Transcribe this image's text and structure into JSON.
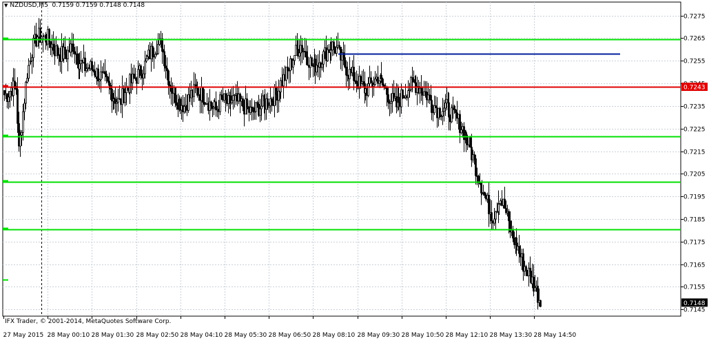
{
  "header": {
    "symbol": "NZDUSD,M5",
    "ohlc": "0.7159 0.7159 0.7148 0.7148"
  },
  "footer": {
    "copyright": "IFX Trader, © 2001-2014, MetaQuotes Software Corp."
  },
  "colors": {
    "background": "#ffffff",
    "grid": "#c8d0d8",
    "candle": "#000000",
    "green_levels": "#00e000",
    "red_level": "#e00000",
    "blue_line": "#001f9e",
    "price_tag_red": "#e00000",
    "price_tag_current": "#000000"
  },
  "chart_data": {
    "type": "candlestick",
    "symbol": "NZDUSD",
    "timeframe": "M5",
    "ylim": [
      0.7142,
      0.7281
    ],
    "y_ticks": [
      "0.7275",
      "0.7265",
      "0.7255",
      "0.7245",
      "0.7235",
      "0.7225",
      "0.7215",
      "0.7205",
      "0.7195",
      "0.7185",
      "0.7175",
      "0.7165",
      "0.7155",
      "0.7145"
    ],
    "x_ticks": [
      "27 May 2015",
      "28 May 00:10",
      "28 May 01:30",
      "28 May 02:50",
      "28 May 04:10",
      "28 May 05:30",
      "28 May 06:50",
      "28 May 08:10",
      "28 May 09:30",
      "28 May 10:50",
      "28 May 12:10",
      "28 May 13:30",
      "28 May 14:50"
    ],
    "grid": true,
    "horizontal_levels": [
      {
        "price": 0.72645,
        "color": "green"
      },
      {
        "price": 0.72435,
        "color": "red",
        "label": "0.7243"
      },
      {
        "price": 0.72215,
        "color": "green"
      },
      {
        "price": 0.72015,
        "color": "green"
      },
      {
        "price": 0.71805,
        "color": "green"
      }
    ],
    "trend_line": {
      "from_time": "28 May 08:20",
      "to_time": "28 May 15:40",
      "price": 0.72582,
      "color": "blue"
    },
    "current_price": "0.7148",
    "close_path": [
      [
        0.724,
        3
      ],
      [
        0.7243,
        3
      ],
      [
        0.7243,
        4
      ],
      [
        0.7215,
        2
      ],
      [
        0.725,
        6
      ],
      [
        0.726,
        4
      ],
      [
        0.7266,
        4
      ],
      [
        0.7265,
        5
      ],
      [
        0.7265,
        3
      ],
      [
        0.726,
        5
      ],
      [
        0.7258,
        4
      ],
      [
        0.7258,
        5
      ],
      [
        0.7262,
        5
      ],
      [
        0.7255,
        4
      ],
      [
        0.7252,
        5
      ],
      [
        0.7252,
        4
      ],
      [
        0.725,
        4
      ],
      [
        0.7248,
        4
      ],
      [
        0.7245,
        4
      ],
      [
        0.724,
        5
      ],
      [
        0.7236,
        5
      ],
      [
        0.7242,
        4
      ],
      [
        0.7245,
        4
      ],
      [
        0.7248,
        5
      ],
      [
        0.7252,
        5
      ],
      [
        0.7258,
        5
      ],
      [
        0.7262,
        5
      ],
      [
        0.7262,
        4
      ],
      [
        0.7245,
        6
      ],
      [
        0.7238,
        5
      ],
      [
        0.7235,
        6
      ],
      [
        0.724,
        5
      ],
      [
        0.7242,
        4
      ],
      [
        0.724,
        5
      ],
      [
        0.7236,
        5
      ],
      [
        0.7233,
        5
      ],
      [
        0.7238,
        4
      ],
      [
        0.7236,
        5
      ],
      [
        0.7238,
        4
      ],
      [
        0.7236,
        5
      ],
      [
        0.7234,
        5
      ],
      [
        0.7232,
        4
      ],
      [
        0.7234,
        4
      ],
      [
        0.7236,
        5
      ],
      [
        0.7238,
        5
      ],
      [
        0.724,
        4
      ],
      [
        0.7245,
        4
      ],
      [
        0.725,
        5
      ],
      [
        0.7258,
        5
      ],
      [
        0.7262,
        5
      ],
      [
        0.7258,
        4
      ],
      [
        0.7252,
        5
      ],
      [
        0.7255,
        5
      ],
      [
        0.7258,
        4
      ],
      [
        0.7262,
        5
      ],
      [
        0.726,
        4
      ],
      [
        0.7255,
        4
      ],
      [
        0.725,
        5
      ],
      [
        0.7248,
        4
      ],
      [
        0.7244,
        5
      ],
      [
        0.7242,
        4
      ],
      [
        0.7245,
        5
      ],
      [
        0.7248,
        4
      ],
      [
        0.7243,
        5
      ],
      [
        0.7238,
        5
      ],
      [
        0.7235,
        4
      ],
      [
        0.724,
        5
      ],
      [
        0.7243,
        4
      ],
      [
        0.7245,
        5
      ],
      [
        0.7243,
        4
      ],
      [
        0.724,
        5
      ],
      [
        0.7236,
        5
      ],
      [
        0.7233,
        4
      ],
      [
        0.7235,
        5
      ],
      [
        0.7232,
        4
      ],
      [
        0.723,
        4
      ],
      [
        0.7225,
        5
      ],
      [
        0.7218,
        5
      ],
      [
        0.721,
        4
      ],
      [
        0.72,
        5
      ],
      [
        0.7192,
        5
      ],
      [
        0.7186,
        4
      ],
      [
        0.7195,
        5
      ],
      [
        0.719,
        4
      ],
      [
        0.7178,
        5
      ],
      [
        0.7172,
        5
      ],
      [
        0.7165,
        4
      ],
      [
        0.716,
        5
      ],
      [
        0.7155,
        4
      ],
      [
        0.7148,
        4
      ]
    ]
  }
}
